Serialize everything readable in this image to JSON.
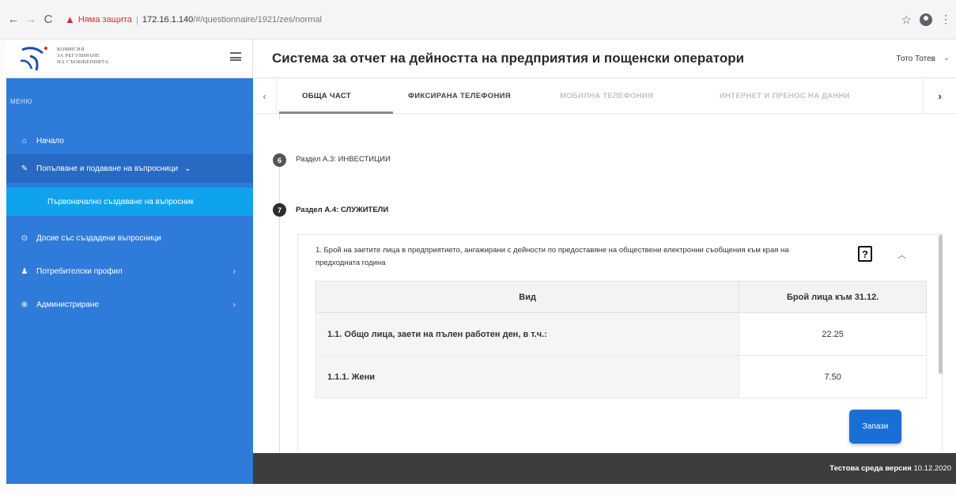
{
  "browser": {
    "nav_back": "←",
    "nav_forward": "→",
    "reload": "C",
    "security_warning": "Няма защита",
    "url_host": "172.16.1.140",
    "url_path": "/#/questionnaire/1921/zes/normal",
    "star": "☆",
    "menu": "⋮"
  },
  "logo": {
    "line1": "КОМИСИЯ",
    "line2": "ЗА РЕГУЛИРАНЕ",
    "line3": "НА СЪОБЩЕНИЯТА"
  },
  "header": {
    "title": "Система за отчет на дейността на предприятия и пощенски оператори",
    "user_name": "Тото Тотев"
  },
  "sidebar": {
    "caption": "МЕНЮ",
    "items": [
      {
        "label": "Начало",
        "icon": "home-icon",
        "glyph": "⌂"
      },
      {
        "label": "Попълване и подаване на въпросници",
        "icon": "pencil-icon",
        "glyph": "✎"
      },
      {
        "label": "Първоначално създаване на въпросник"
      },
      {
        "label": "Досие със създадени въпросници",
        "icon": "history-icon",
        "glyph": "⊙"
      },
      {
        "label": "Потребителски профил",
        "icon": "user-icon",
        "glyph": "♟"
      },
      {
        "label": "Администриране",
        "icon": "globe-icon",
        "glyph": "⊕"
      }
    ]
  },
  "tabs": [
    {
      "label": "ОБЩА ЧАСТ",
      "state": "active"
    },
    {
      "label": "ФИКСИРАНА ТЕЛЕФОНИЯ",
      "state": "enabled"
    },
    {
      "label": "МОБИЛНА ТЕЛЕФОНИЯ",
      "state": "disabled"
    },
    {
      "label": "ИНТЕРНЕТ И ПРЕНОС НА ДАННИ",
      "state": "disabled"
    }
  ],
  "steps": [
    {
      "number": "6",
      "label": "Раздел А.3: ИНВЕСТИЦИИ"
    },
    {
      "number": "7",
      "label": "Раздел А.4: СЛУЖИТЕЛИ"
    }
  ],
  "question": {
    "text": "1. Брой на заетите лица в предприятието, ангажирани с дейности по предоставяне на обществени електронни съобщения към края на предходната година",
    "help": "?",
    "columns": [
      "Вид",
      "Брой лица към 31.12."
    ],
    "rows": [
      {
        "label": "1.1. Общо лица, заети на пълен работен ден, в т.ч.:",
        "value": "22.25"
      },
      {
        "label": "1.1.1. Жени",
        "value": "7.50"
      }
    ],
    "save_label": "Запази"
  },
  "footer": {
    "env_label": "Тестова среда версия",
    "version_date": "10.12.2020"
  },
  "colors": {
    "sidebar": "#2f7bd9",
    "sidebar_active": "#10a3ed",
    "primary_button": "#1a6fd6",
    "footer": "#3d3d3d"
  }
}
